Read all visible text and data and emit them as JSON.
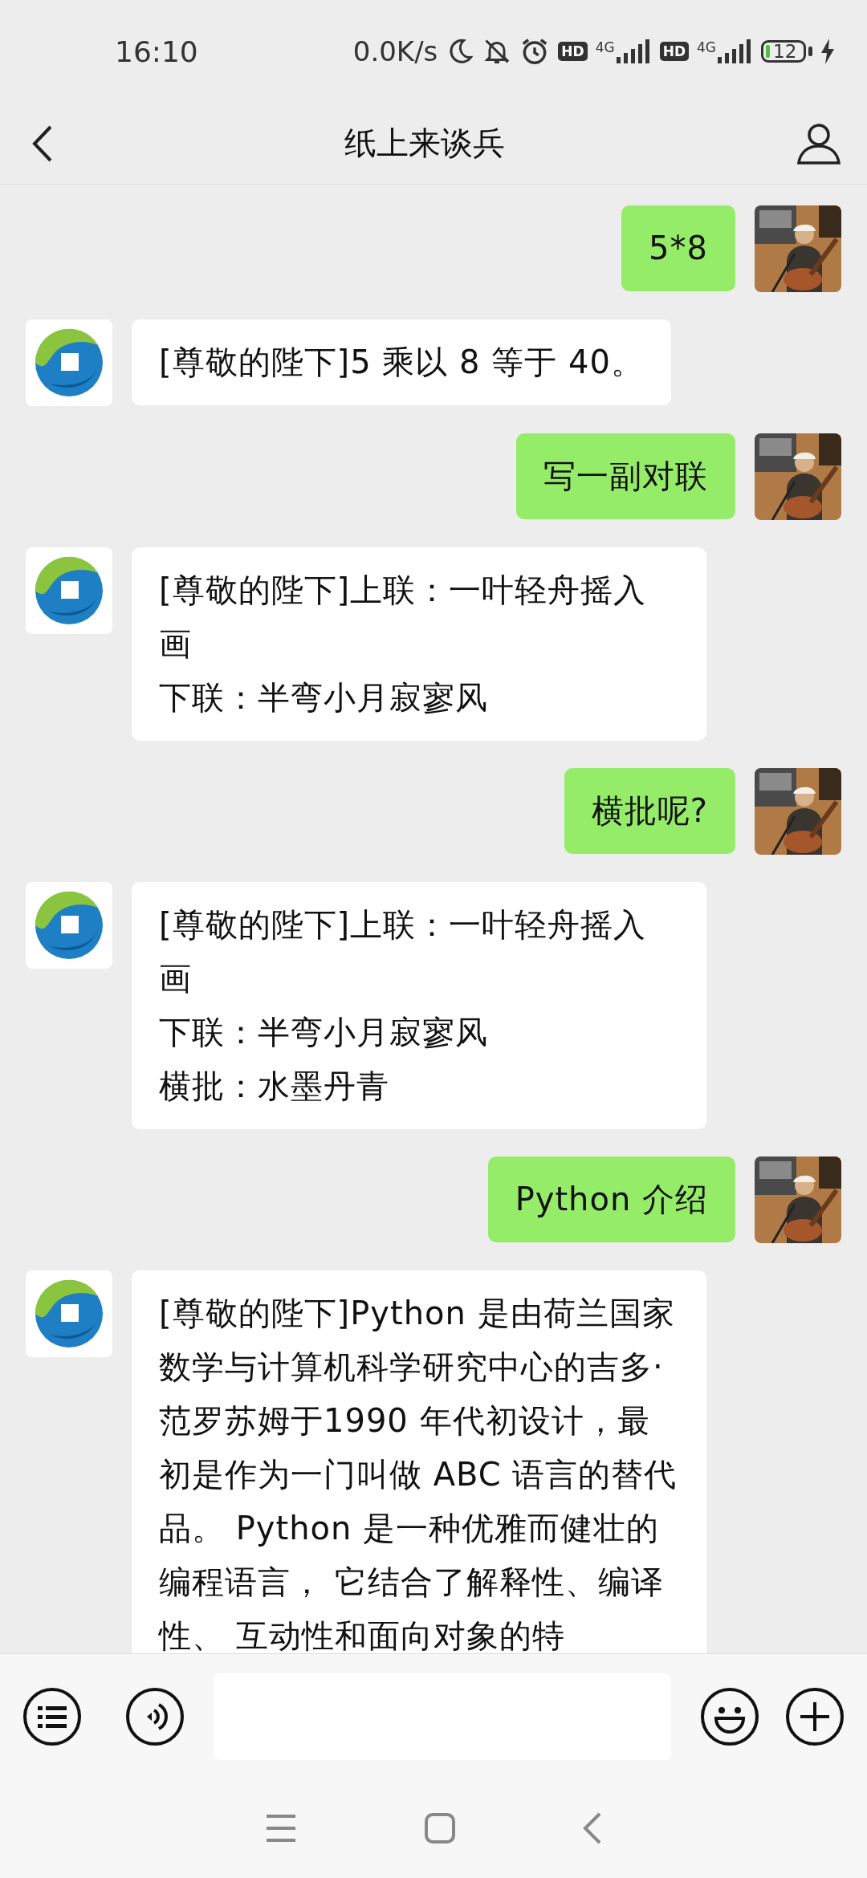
{
  "status_bar": {
    "time": "16:10",
    "net_speed": "0.0K/s",
    "sims": [
      {
        "hd": "HD",
        "network": "4G"
      },
      {
        "hd": "HD",
        "network": "4G"
      }
    ],
    "battery": "12"
  },
  "header": {
    "title": "纸上来谈兵"
  },
  "messages": [
    {
      "kind": "sent",
      "lines": [
        "5*8"
      ]
    },
    {
      "kind": "received",
      "lines": [
        "[尊敬的陛下]5 乘以 8 等于 40。"
      ]
    },
    {
      "kind": "sent",
      "lines": [
        "写一副对联"
      ]
    },
    {
      "kind": "received",
      "lines": [
        "[尊敬的陛下]上联：一叶轻舟摇入画",
        "下联：半弯小月寂寥风"
      ]
    },
    {
      "kind": "sent",
      "lines": [
        "横批呢?"
      ]
    },
    {
      "kind": "received",
      "lines": [
        "[尊敬的陛下]上联：一叶轻舟摇入画",
        "下联：半弯小月寂寥风",
        "横批：水墨丹青"
      ]
    },
    {
      "kind": "sent",
      "lines": [
        "Python 介绍"
      ]
    },
    {
      "kind": "received",
      "lines": [
        "[尊敬的陛下]Python 是由荷兰国家数学与计算机科学研究中心的吉多·范罗苏姆于1990 年代初设计，最初是作为一门叫做 ABC 语言的替代品。 Python 是一种优雅而健壮的编程语言， 它结合了解释性、编译性、 互动性和面向对象的特"
      ]
    }
  ]
}
